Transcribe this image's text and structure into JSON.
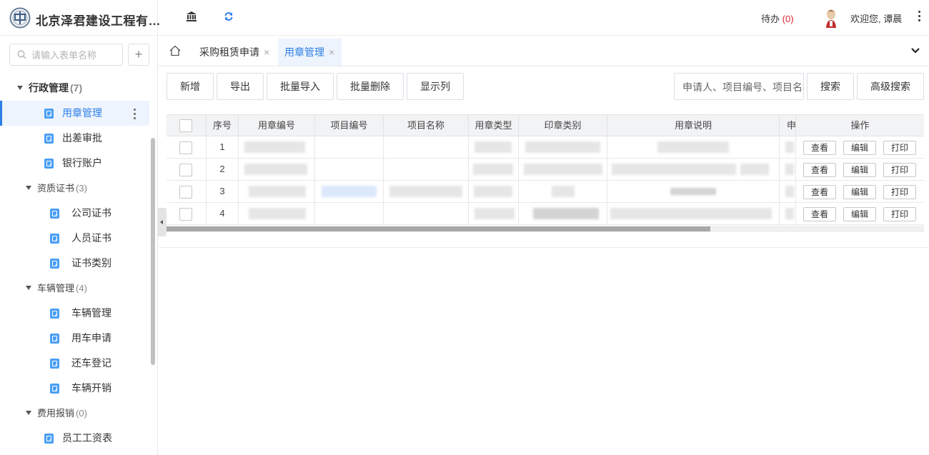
{
  "app": {
    "company": "北京泽君建设工程有…",
    "colors": {
      "accent": "#2b7fe6",
      "danger": "#d9202c",
      "icon_blue": "#4a9ff5"
    }
  },
  "sidebar": {
    "search_placeholder": "请输入表单名称",
    "add_label": "+",
    "groups": [
      {
        "label": "行政管理",
        "count": "(7)",
        "items": [
          "用章管理",
          "出差审批",
          "银行账户"
        ]
      },
      {
        "label": "资质证书",
        "count": "(3)",
        "items": [
          "公司证书",
          "人员证书",
          "证书类别"
        ]
      },
      {
        "label": "车辆管理",
        "count": "(4)",
        "items": [
          "车辆管理",
          "用车申请",
          "还车登记",
          "车辆开销"
        ]
      },
      {
        "label": "费用报销",
        "count": "(0)",
        "items": [
          "员工工资表"
        ]
      }
    ],
    "active_item": "用章管理"
  },
  "topbar": {
    "todo_label": "待办",
    "todo_count": "(0)",
    "welcome": "欢迎您, 谭晨",
    "icons": [
      "bank-icon",
      "refresh-icon",
      "more-vertical-icon"
    ]
  },
  "tabs": {
    "items": [
      {
        "label": "采购租赁申请",
        "close": "×"
      },
      {
        "label": "用章管理",
        "close": "×"
      }
    ],
    "active": 1
  },
  "toolbar": {
    "add": "新增",
    "export": "导出",
    "batch_import": "批量导入",
    "batch_delete": "批量删除",
    "show_columns": "显示列",
    "filter_placeholder": "申请人、项目编号、项目名称",
    "search": "搜索",
    "advanced_search": "高级搜索"
  },
  "table": {
    "headers": [
      "序号",
      "用章编号",
      "项目编号",
      "项目名称",
      "用章类型",
      "印章类别",
      "用章说明",
      "申",
      "操作"
    ],
    "rows": [
      {
        "index": "1"
      },
      {
        "index": "2"
      },
      {
        "index": "3"
      },
      {
        "index": "4"
      }
    ],
    "actions": [
      "查看",
      "编辑",
      "打印"
    ]
  }
}
